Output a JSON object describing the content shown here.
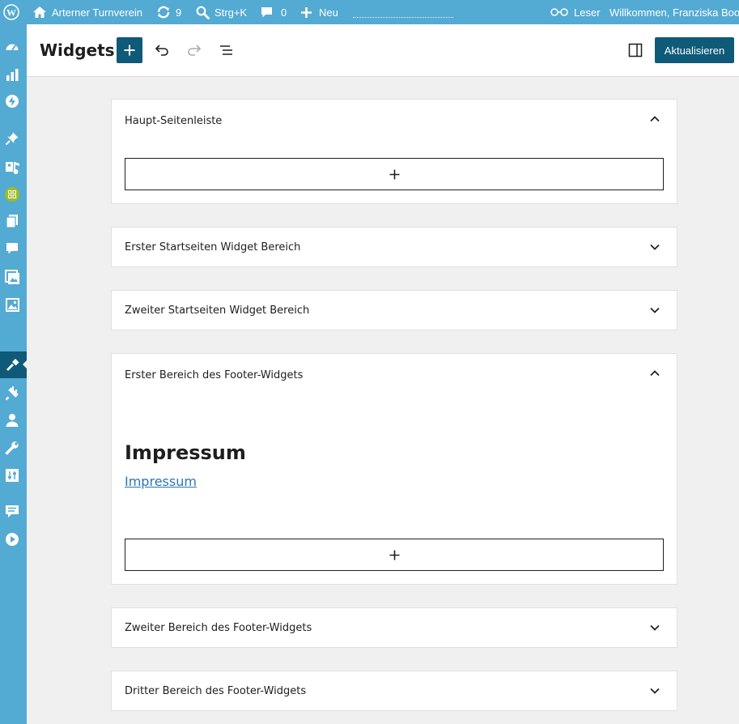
{
  "adminbar": {
    "site_name": "Arterner Turnverein",
    "updates_count": "9",
    "shortcut": "Strg+K",
    "comments_count": "0",
    "new_label": "Neu",
    "reader_label": "Leser",
    "welcome": "Willkommen, Franziska Boos"
  },
  "sidebar": {
    "icons": [
      "dashboard-icon",
      "stats-icon",
      "jetpack-icon",
      "pin-icon",
      "media-icon",
      "badge-icon",
      "pages-icon",
      "comments-icon",
      "gallery-icon",
      "image-icon",
      "appearance-icon",
      "plugins-icon",
      "users-icon",
      "tools-icon",
      "settings-icon",
      "feedback-icon",
      "play-icon"
    ],
    "active": "appearance"
  },
  "header": {
    "title": "Widgets",
    "update_label": "Aktualisieren"
  },
  "areas": [
    {
      "title": "Haupt-Seitenleiste",
      "expanded": true
    },
    {
      "title": "Erster Startseiten Widget Bereich",
      "expanded": false
    },
    {
      "title": "Zweiter Startseiten Widget Bereich",
      "expanded": false
    },
    {
      "title": "Erster Bereich des Footer-Widgets",
      "expanded": true,
      "heading": "Impressum",
      "link": "Impressum"
    },
    {
      "title": "Zweiter Bereich des Footer-Widgets",
      "expanded": false
    },
    {
      "title": "Dritter Bereich des Footer-Widgets",
      "expanded": false
    }
  ],
  "colors": {
    "accent": "#0e5a78",
    "adminbar": "#53aad3",
    "link": "#2b76b8"
  }
}
